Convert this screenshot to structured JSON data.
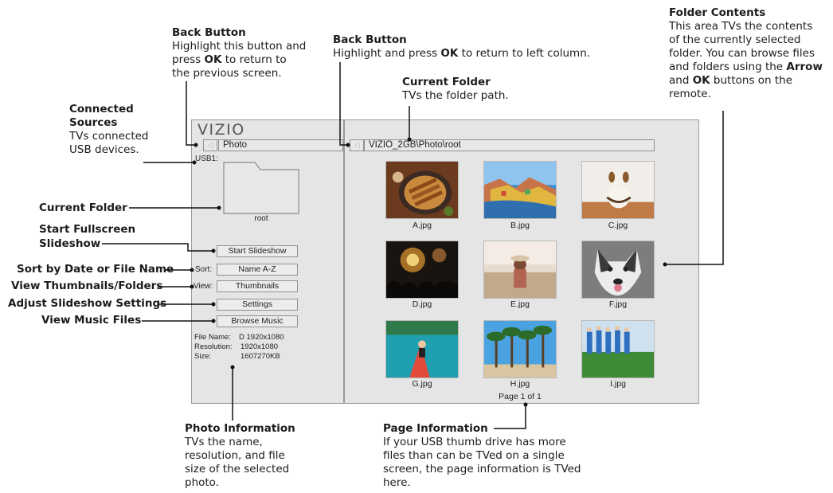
{
  "screen": {
    "logo": "VIZIO",
    "left_path": "Photo",
    "right_path": "VIZIO_2GB\\Photo\\root",
    "source_label": "USB1:",
    "folder_name": "root",
    "buttons": {
      "start_slideshow": "Start Slideshow",
      "sort_label": "Sort:",
      "sort_value": "Name A-Z",
      "view_label": "View:",
      "view_value": "Thumbnails",
      "settings": "Settings",
      "browse_music": "Browse Music"
    },
    "photo_info": {
      "file_name_label": "File Name:",
      "file_name": "D 1920x1080",
      "resolution_label": "Resolution:",
      "resolution": "1920x1080",
      "size_label": "Size:",
      "size": "1607270KB"
    },
    "thumbnails": [
      "A.jpg",
      "B.jpg",
      "C.jpg",
      "D.jpg",
      "E.jpg",
      "F.jpg",
      "G.jpg",
      "H.jpg",
      "I.jpg"
    ],
    "page_info": "Page 1 of 1"
  },
  "callouts": {
    "connected_sources": {
      "title": "Connected Sources",
      "title_line1": "Connected",
      "title_line2": "Sources",
      "text_line1": "TVs connected",
      "text_line2": "USB devices."
    },
    "back_button_left": {
      "title": "Back Button",
      "l1": "Highlight this button and",
      "l2_pre": "press ",
      "l2_bold": "OK",
      "l2_post": " to return to",
      "l3": "the previous screen."
    },
    "back_button_right": {
      "title": "Back Button",
      "l1_pre": "Highlight and press ",
      "l1_bold": "OK",
      "l1_post": " to return to left column."
    },
    "current_folder_top": {
      "title": "Current Folder",
      "text": "TVs the folder path."
    },
    "folder_contents": {
      "title": "Folder Contents",
      "l1": "This area TVs the contents",
      "l2": "of the currently selected",
      "l3": "folder. You can browse files",
      "l4_pre": "and folders using the ",
      "l4_bold": "Arrow",
      "l5_pre": "and ",
      "l5_bold": "OK",
      "l5_post": " buttons on the",
      "l6": "remote."
    },
    "current_folder_left": "Current Folder",
    "start_fullscreen_line1": "Start Fullscreen",
    "start_fullscreen_line2": "Slideshow",
    "sort": "Sort by Date or File Name",
    "view": "View Thumbnails/Folders",
    "adjust": "Adjust Slideshow Settings",
    "music": "View Music Files",
    "photo_information": {
      "title": "Photo Information",
      "l1": "TVs the name,",
      "l2": "resolution, and file",
      "l3": "size of the selected",
      "l4": "photo."
    },
    "page_information": {
      "title": "Page Information",
      "l1": "If your USB thumb drive has more",
      "l2": "files than can be TVed on a single",
      "l3": "screen, the page information is TVed",
      "l4": "here."
    }
  }
}
